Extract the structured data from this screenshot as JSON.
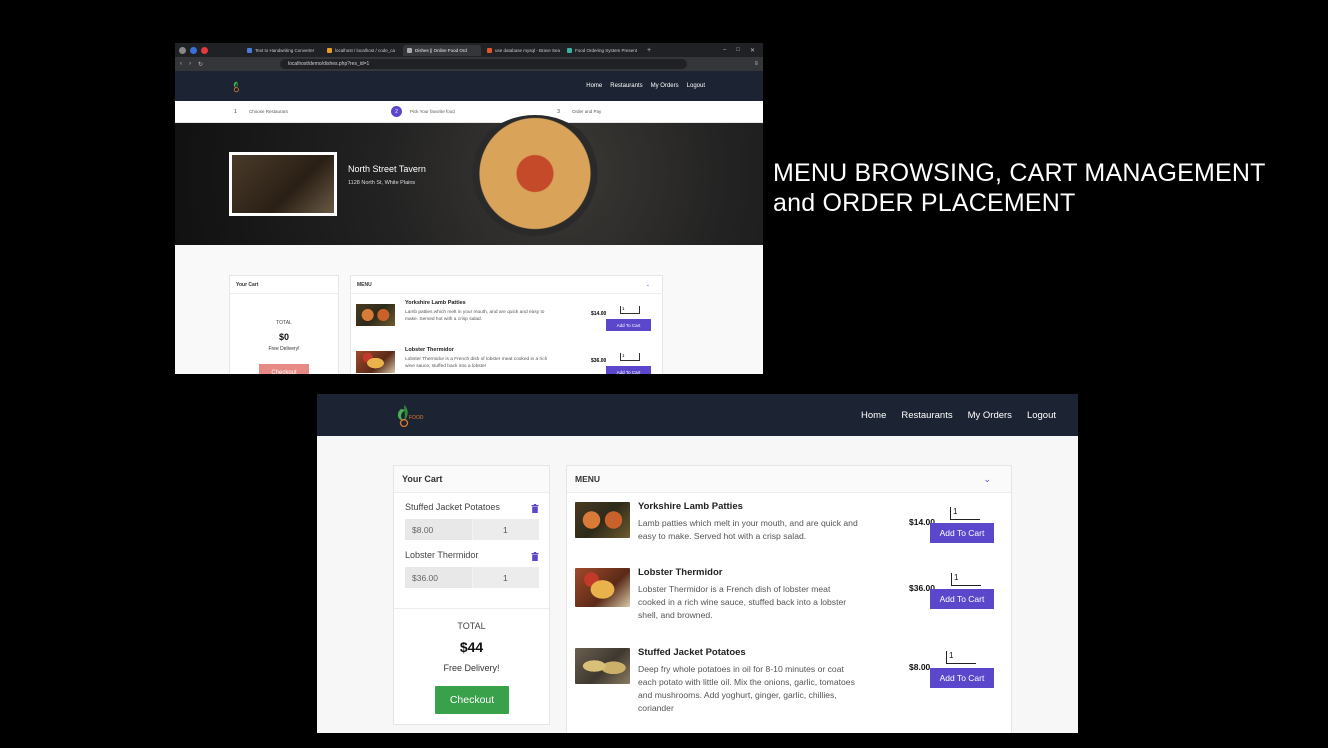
{
  "caption": "MENU BROWSING, CART MANAGEMENT and ORDER PLACEMENT",
  "browser": {
    "tabs": [
      {
        "label": "Text to Handwriting Converter",
        "active": false
      },
      {
        "label": "localhost / localhost / code_ca",
        "active": false
      },
      {
        "label": "Dishes || Online Food Ord",
        "active": true
      },
      {
        "label": "use database mysql - Brave Sea",
        "active": false
      },
      {
        "label": "Food Ordering System Present",
        "active": false
      }
    ],
    "url": "localhost/demo/dishes.php?res_id=1"
  },
  "nav": {
    "logo_text": "FOOD",
    "links": [
      "Home",
      "Restaurants",
      "My Orders",
      "Logout"
    ]
  },
  "steps": [
    {
      "num": "1",
      "label": "Choose Restaurant"
    },
    {
      "num": "2",
      "label": "Pick Your favorite food"
    },
    {
      "num": "3",
      "label": "Order and Pay"
    }
  ],
  "restaurant": {
    "name": "North Street Tavern",
    "address": "1128 North St, White Plains"
  },
  "shot1": {
    "cart": {
      "title": "Your Cart",
      "total_label": "TOTAL",
      "total": "$0",
      "delivery": "Free Delivery!",
      "checkout": "Checkout"
    },
    "menu_title": "MENU",
    "dishes": [
      {
        "name": "Yorkshire Lamb Patties",
        "desc": "Lamb patties which melt in your mouth, and are quick and easy to make. Served hot with a crisp salad.",
        "price": "$14.00",
        "qty": "1",
        "button": "Add To Cart"
      },
      {
        "name": "Lobster Thermidor",
        "desc": "Lobster Thermidor is a French dish of lobster meat cooked in a rich wine sauce, stuffed back into a lobster",
        "price": "$36.00",
        "qty": "1",
        "button": "Add To Cart"
      }
    ]
  },
  "shot2": {
    "cart": {
      "title": "Your Cart",
      "items": [
        {
          "name": "Stuffed Jacket Potatoes",
          "price": "$8.00",
          "qty": "1"
        },
        {
          "name": "Lobster Thermidor",
          "price": "$36.00",
          "qty": "1"
        }
      ],
      "total_label": "TOTAL",
      "total": "$44",
      "delivery": "Free Delivery!",
      "checkout": "Checkout"
    },
    "menu_title": "MENU",
    "dishes": [
      {
        "name": "Yorkshire Lamb Patties",
        "desc": "Lamb patties which melt in your mouth, and are quick and easy to make. Served hot with a crisp salad.",
        "price": "$14.00",
        "qty": "1",
        "button": "Add To Cart"
      },
      {
        "name": "Lobster Thermidor",
        "desc": "Lobster Thermidor is a French dish of lobster meat cooked in a rich wine sauce, stuffed back into a lobster shell, and browned.",
        "price": "$36.00",
        "qty": "1",
        "button": "Add To Cart"
      },
      {
        "name": "Stuffed Jacket Potatoes",
        "desc": "Deep fry whole potatoes in oil for 8-10 minutes or coat each potato with little oil. Mix the onions, garlic, tomatoes and mushrooms. Add yoghurt, ginger, garlic, chillies, coriander",
        "price": "$8.00",
        "qty": "1",
        "button": "Add To Cart"
      }
    ]
  },
  "colors": {
    "accent": "#5b47cc",
    "checkout_active": "#3aa14b",
    "checkout_disabled": "#e78a86",
    "navbar": "#1c2332"
  }
}
